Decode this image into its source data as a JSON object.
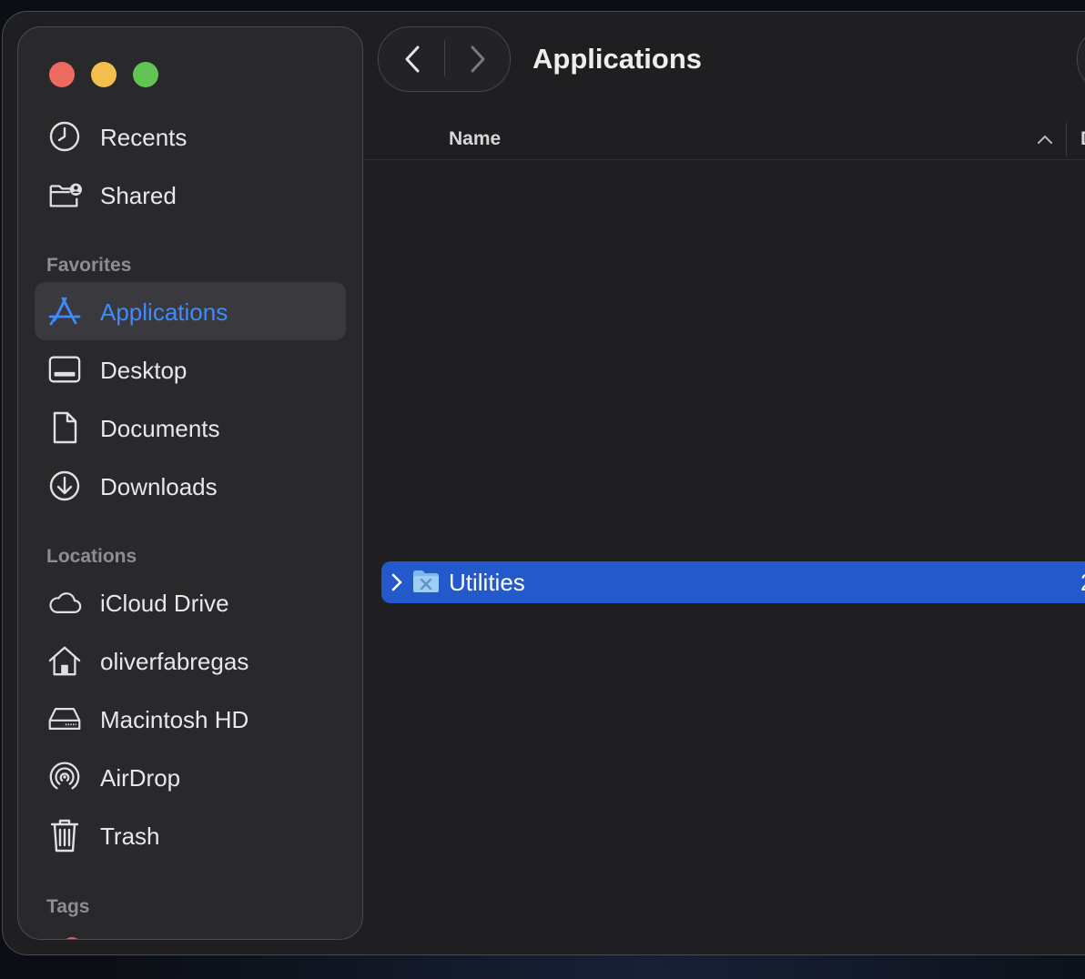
{
  "window": {
    "title": "Applications"
  },
  "toolbar": {
    "back_icon": "chevron-left-icon",
    "forward_icon": "chevron-right-icon"
  },
  "sidebar": {
    "top_items": [
      {
        "label": "Recents",
        "icon": "clock-icon"
      },
      {
        "label": "Shared",
        "icon": "shared-folder-icon"
      }
    ],
    "favorites_heading": "Favorites",
    "favorites": [
      {
        "label": "Applications",
        "icon": "applications-icon",
        "selected": true
      },
      {
        "label": "Desktop",
        "icon": "desktop-icon"
      },
      {
        "label": "Documents",
        "icon": "document-icon"
      },
      {
        "label": "Downloads",
        "icon": "download-icon"
      }
    ],
    "locations_heading": "Locations",
    "locations": [
      {
        "label": "iCloud Drive",
        "icon": "cloud-icon"
      },
      {
        "label": "oliverfabregas",
        "icon": "home-icon"
      },
      {
        "label": "Macintosh HD",
        "icon": "drive-icon"
      },
      {
        "label": "AirDrop",
        "icon": "airdrop-icon"
      },
      {
        "label": "Trash",
        "icon": "trash-icon"
      }
    ],
    "tags_heading": "Tags"
  },
  "list": {
    "column_name": "Name",
    "column_next_partial": "D",
    "rows": [
      {
        "name": "Utilities",
        "icon": "folder-icon",
        "selected": true,
        "trailing_partial": "2"
      }
    ]
  },
  "colors": {
    "accent": "#3d8bfd",
    "selection": "#2459cc",
    "close": "#ed6a5e",
    "minimize": "#f4be4f",
    "zoom": "#61c454"
  }
}
